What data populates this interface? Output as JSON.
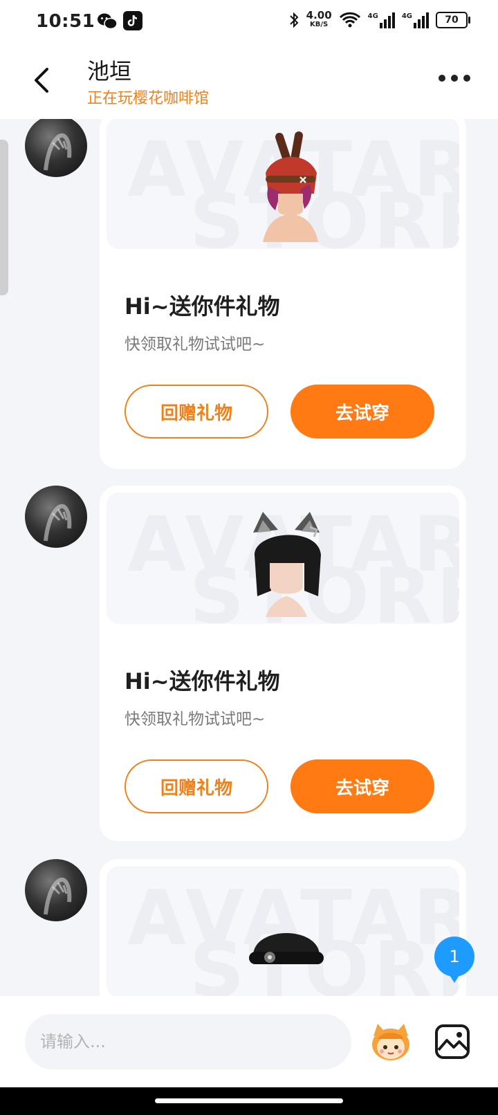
{
  "status_bar": {
    "time": "10:51",
    "network_speed": "4.00",
    "network_unit": "KB/S",
    "signal_1": "4G",
    "signal_2": "4G",
    "battery": "70"
  },
  "header": {
    "title": "池垣",
    "status": "正在玩樱花咖啡馆"
  },
  "messages": [
    {
      "watermark_top": "AVATAR",
      "watermark_bottom": "STORE",
      "title": "Hi~送你件礼物",
      "subtitle": "快领取礼物试试吧~",
      "return_gift_label": "回赠礼物",
      "try_on_label": "去试穿"
    },
    {
      "watermark_top": "AVATAR",
      "watermark_bottom": "STORE",
      "title": "Hi~送你件礼物",
      "subtitle": "快领取礼物试试吧~",
      "return_gift_label": "回赠礼物",
      "try_on_label": "去试穿"
    },
    {
      "watermark_top": "AVATAR",
      "watermark_bottom": "STORE"
    }
  ],
  "unread_count": "1",
  "input": {
    "placeholder": "请输入..."
  },
  "colors": {
    "accent": "#FF7A12",
    "status_text": "#F08019",
    "badge": "#1E9BFF",
    "background": "#F3F5F9"
  },
  "icons": {
    "back": "chevron-left-icon",
    "more": "more-dots-icon",
    "mascot": "mascot-icon",
    "image": "image-icon"
  }
}
